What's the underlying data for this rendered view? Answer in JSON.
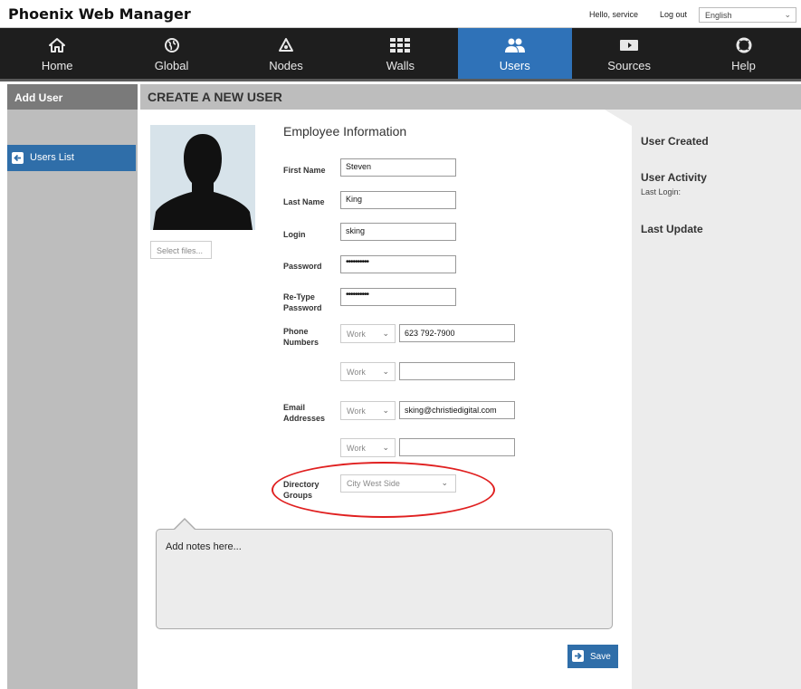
{
  "header": {
    "app_title": "Phoenix Web Manager",
    "greeting": "Hello, service",
    "logout_label": "Log out",
    "language_selected": "English"
  },
  "nav": {
    "active": "Users",
    "items": [
      {
        "label": "Home",
        "icon": "home-icon"
      },
      {
        "label": "Global",
        "icon": "globe-icon"
      },
      {
        "label": "Nodes",
        "icon": "nodes-icon"
      },
      {
        "label": "Walls",
        "icon": "walls-grid-icon"
      },
      {
        "label": "Users",
        "icon": "users-icon"
      },
      {
        "label": "Sources",
        "icon": "video-camera-icon"
      },
      {
        "label": "Help",
        "icon": "lifebuoy-icon"
      }
    ]
  },
  "sidebar": {
    "title": "Add User",
    "users_list_label": "Users List"
  },
  "main": {
    "title": "CREATE A NEW USER",
    "select_files_label": "Select files...",
    "section_title": "Employee Information",
    "fields": {
      "first_name_label": "First Name",
      "first_name_value": "Steven",
      "last_name_label": "Last Name",
      "last_name_value": "King",
      "login_label": "Login",
      "login_value": "sking",
      "password_label": "Password",
      "password_mask": "••••••••••",
      "retype_password_label_1": "Re-Type",
      "retype_password_label_2": "Password",
      "retype_password_mask": "••••••••••",
      "phone_label_1": "Phone",
      "phone_label_2": "Numbers",
      "phone_1_type": "Work",
      "phone_1_value": "623 792-7900",
      "phone_2_type": "Work",
      "phone_2_value": "",
      "email_label_1": "Email",
      "email_label_2": "Addresses",
      "email_1_type": "Work",
      "email_1_value": "sking@christiedigital.com",
      "email_2_type": "Work",
      "email_2_value": "",
      "directory_label_1": "Directory",
      "directory_label_2": "Groups",
      "directory_value": "City West Side"
    },
    "notes_placeholder": "Add notes here...",
    "save_label": "Save"
  },
  "right_panel": {
    "user_created": "User Created",
    "user_activity": "User Activity",
    "last_login": "Last Login:",
    "last_update": "Last Update"
  },
  "colors": {
    "nav_bg": "#1e1e1e",
    "nav_active": "#2f72b8",
    "button_blue": "#2f6ea9",
    "sidebar_gray": "#bdbdbd",
    "highlight_red": "#e02020"
  }
}
